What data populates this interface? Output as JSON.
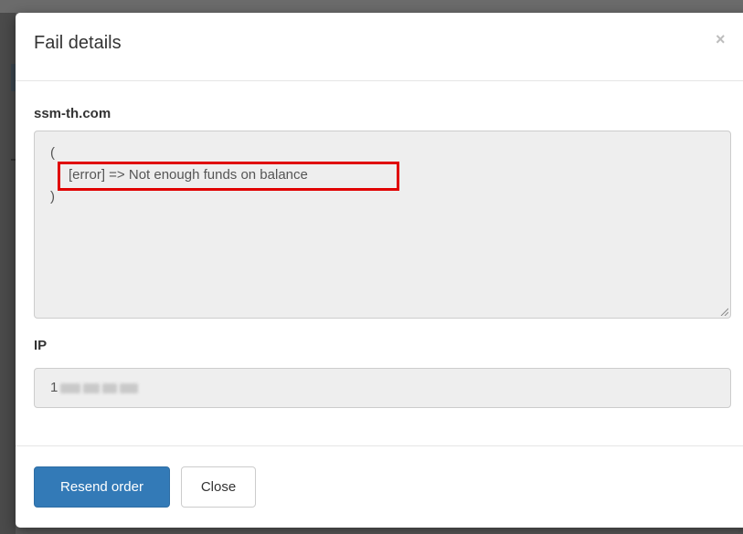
{
  "modal": {
    "title": "Fail details",
    "close_glyph": "×",
    "domain_label": "ssm-th.com",
    "details_lines": [
      "(",
      "[error] => Not enough funds on balance",
      ")"
    ],
    "ip_label": "IP",
    "ip_value_visible_prefix": "1"
  },
  "footer": {
    "resend_label": "Resend order",
    "close_label": "Close"
  },
  "colors": {
    "primary_button": "#337ab7",
    "highlight": "#e00000",
    "field_background": "#eeeeee"
  },
  "icons": [
    "close-icon",
    "resize-grip-icon"
  ]
}
